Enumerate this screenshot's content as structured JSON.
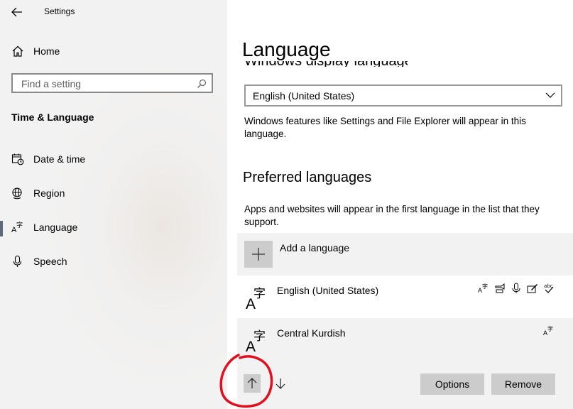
{
  "window": {
    "title": "Settings"
  },
  "sidebar": {
    "home": "Home",
    "search": {
      "placeholder": "Find a setting"
    },
    "section": "Time & Language",
    "items": [
      {
        "label": "Date & time",
        "icon": "calendar-clock-icon"
      },
      {
        "label": "Region",
        "icon": "globe-icon"
      },
      {
        "label": "Language",
        "icon": "language-icon",
        "selected": true
      },
      {
        "label": "Speech",
        "icon": "microphone-icon"
      }
    ]
  },
  "main": {
    "title": "Language",
    "cutoff_heading": "Windows display language",
    "display_language": {
      "value": "English (United States)",
      "description": "Windows features like Settings and File Explorer will appear in this language."
    },
    "preferred": {
      "heading": "Preferred languages",
      "description": "Apps and websites will appear in the first language in the list that they support.",
      "add_label": "Add a language",
      "languages": [
        {
          "name": "English (United States)",
          "features": [
            "display-language-icon",
            "text-to-speech-icon",
            "speech-recognition-icon",
            "handwriting-icon",
            "spell-check-icon"
          ]
        },
        {
          "name": "Central Kurdish",
          "features": [
            "display-language-icon"
          ]
        }
      ],
      "options_label": "Options",
      "remove_label": "Remove"
    }
  },
  "colors": {
    "sidebar_bg": "#f2f2f2",
    "button_bg": "#cccccc",
    "annotation": "#e0101e",
    "selection_bar": "#5e6a78"
  }
}
